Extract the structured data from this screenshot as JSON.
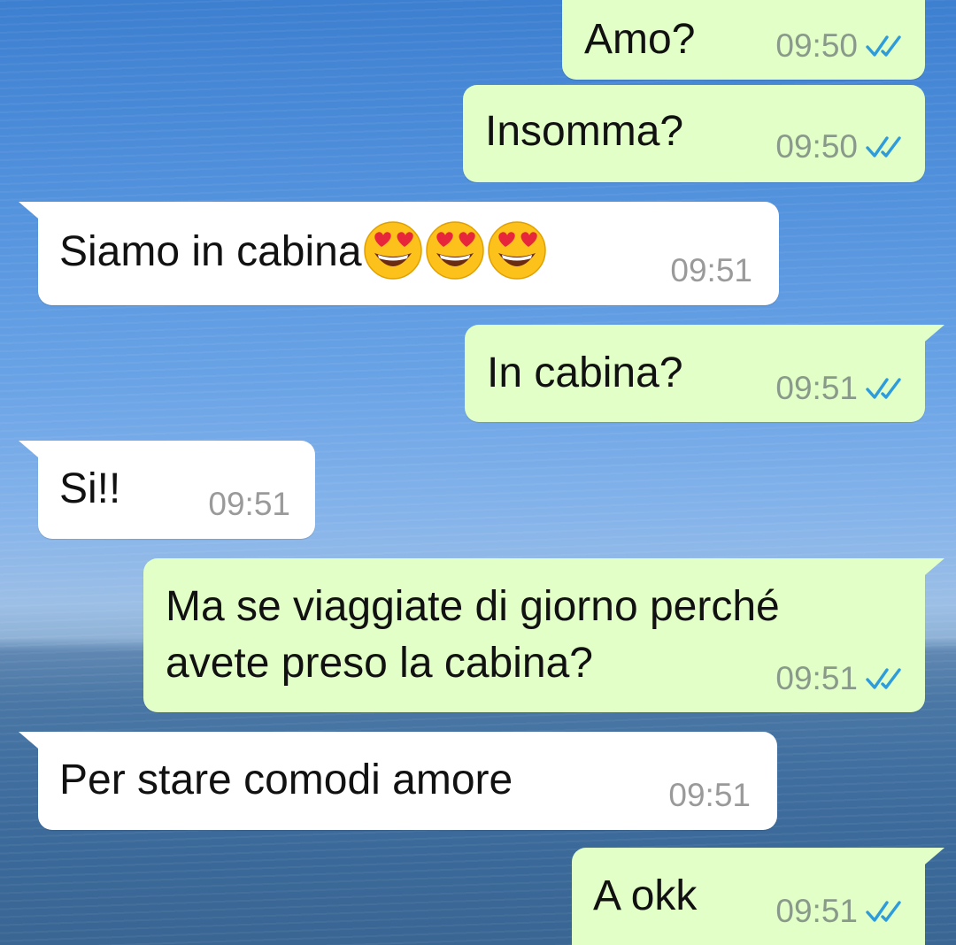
{
  "chat": {
    "messages": [
      {
        "direction": "outgoing",
        "text": "Amo?",
        "time": "09:50",
        "status": "read"
      },
      {
        "direction": "outgoing",
        "text": "Insomma?",
        "time": "09:50",
        "status": "read"
      },
      {
        "direction": "incoming",
        "text": "Siamo in cabina",
        "emoji": [
          "smiling-face-with-heart-eyes",
          "smiling-face-with-heart-eyes",
          "smiling-face-with-heart-eyes"
        ],
        "time": "09:51"
      },
      {
        "direction": "outgoing",
        "text": "In cabina?",
        "time": "09:51",
        "status": "read"
      },
      {
        "direction": "incoming",
        "text": "Si!!",
        "time": "09:51"
      },
      {
        "direction": "outgoing",
        "lines": [
          "Ma se viaggiate di giorno perché",
          "avete preso la cabina?"
        ],
        "time": "09:51",
        "status": "read"
      },
      {
        "direction": "incoming",
        "text": "Per stare comodi amore",
        "time": "09:51"
      },
      {
        "direction": "outgoing",
        "text": "A okk",
        "time": "09:51",
        "status": "read"
      }
    ]
  },
  "colors": {
    "outgoing_bubble": "#e2ffc8",
    "incoming_bubble": "#ffffff",
    "read_ticks": "#2e9bdb",
    "timestamp": "#8a9a8a"
  },
  "icons": {
    "read_receipt": "double-check-icon",
    "emoji": "smiling-face-with-heart-eyes"
  }
}
